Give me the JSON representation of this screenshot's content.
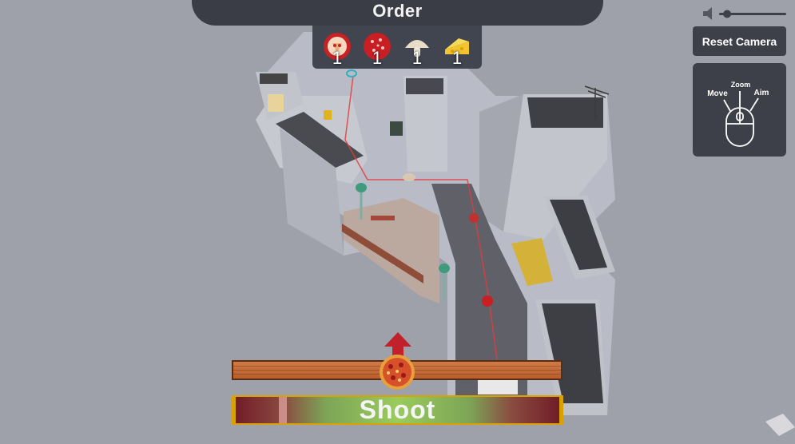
{
  "order": {
    "title": "Order",
    "items": [
      {
        "icon": "pizza-slice-icon",
        "count": "1"
      },
      {
        "icon": "pepperoni-icon",
        "count": "1"
      },
      {
        "icon": "mushroom-icon",
        "count": "1"
      },
      {
        "icon": "cheese-icon",
        "count": "1"
      }
    ]
  },
  "camera": {
    "reset_label": "Reset Camera"
  },
  "controls_help": {
    "zoom": "Zoom",
    "move": "Move",
    "aim": "Aim"
  },
  "volume": {
    "icon": "speaker-icon",
    "level": 0.12
  },
  "shoot": {
    "label": "Shoot",
    "power_level": 0.15
  },
  "aim": {
    "position": 0.5
  },
  "colors": {
    "panel": "#3d4048",
    "laser": "#e23c3c",
    "shoot_border": "#d9a200",
    "aim_bar": "#c86a38"
  }
}
